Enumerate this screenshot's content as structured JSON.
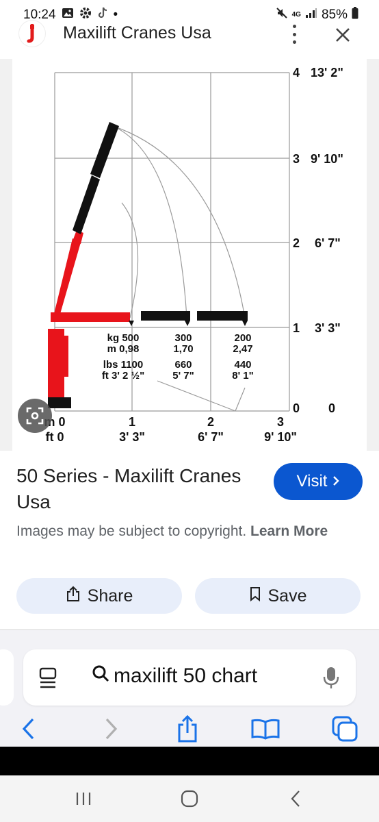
{
  "status_bar": {
    "time": "10:24",
    "dot": "•",
    "network": "4G",
    "battery": "85%",
    "icons": [
      "gallery-icon",
      "settings-icon",
      "tiktok-icon",
      "mute-icon",
      "signal-icon",
      "battery-icon"
    ]
  },
  "header": {
    "site_title": "Maxilift Cranes Usa",
    "logo_color": "#e21b1b",
    "icons": [
      "site-logo-icon",
      "more-vert-icon",
      "close-icon"
    ]
  },
  "image": {
    "right_axis": [
      {
        "m": "4",
        "ft": "13' 2\""
      },
      {
        "m": "3",
        "ft": "9' 10\""
      },
      {
        "m": "2",
        "ft": "6' 7\""
      },
      {
        "m": "1",
        "ft": "3' 3\""
      },
      {
        "m": "0",
        "ft": "0"
      }
    ],
    "bottom_axis": [
      {
        "m": "m 0",
        "ft": "ft 0"
      },
      {
        "m": "1",
        "ft": "3' 3\""
      },
      {
        "m": "2",
        "ft": "6' 7\""
      },
      {
        "m": "3",
        "ft": "9' 10\""
      }
    ],
    "loads": [
      {
        "kg": "kg 500",
        "m": "m 0,98",
        "lbs": "lbs 1100",
        "ft": "ft 3' 2 ½\""
      },
      {
        "kg": "300",
        "m": "1,70",
        "lbs": "660",
        "ft": "5' 7\""
      },
      {
        "kg": "200",
        "m": "2,47",
        "lbs": "440",
        "ft": "8' 1\""
      }
    ],
    "crane_red": "#e8141b",
    "boom_black": "#111111"
  },
  "result": {
    "title": "50 Series - Maxilift Cranes Usa",
    "visit_label": "Visit",
    "visit_color": "#0b57d0",
    "copyright": "Images may be subject to copyright.",
    "learn_more": "Learn More",
    "share_label": "Share",
    "save_label": "Save"
  },
  "browser": {
    "search_query": "maxilift 50 chart",
    "icons": [
      "reader-icon",
      "search-icon",
      "mic-icon",
      "back-icon",
      "forward-icon",
      "share-icon",
      "bookmarks-icon",
      "tabs-icon"
    ],
    "accent": "#1a73e8"
  },
  "android_nav": {
    "icons": [
      "recents-icon",
      "home-icon",
      "back-nav-icon"
    ]
  }
}
